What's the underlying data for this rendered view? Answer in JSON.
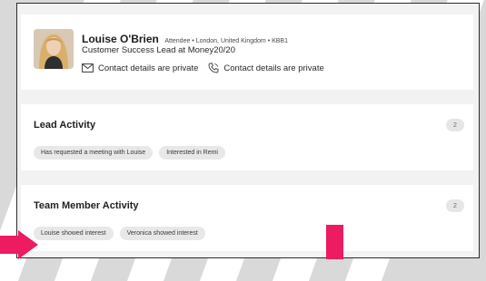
{
  "profile": {
    "name": "Louise O'Brien",
    "meta": "Attendee • London, United Kingdom • KBB1",
    "role": "Customer Success Lead at Money20/20",
    "email_text": "Contact details are private",
    "phone_text": "Contact details are private"
  },
  "lead_activity": {
    "title": "Lead Activity",
    "count": "2",
    "tags": [
      "Has requested a meeting with Louise",
      "Interested in Remi"
    ]
  },
  "team_activity": {
    "title": "Team Member Activity",
    "count": "2",
    "tags": [
      "Louise showed interest",
      "Veronica showed interest"
    ]
  },
  "colors": {
    "accent_pink": "#ec1b62",
    "card_bg": "#ffffff",
    "panel_bg": "#f2f2f2",
    "tag_bg": "#e8e8e8"
  },
  "icons": [
    "mail-icon",
    "phone-icon",
    "arrow-icon"
  ]
}
